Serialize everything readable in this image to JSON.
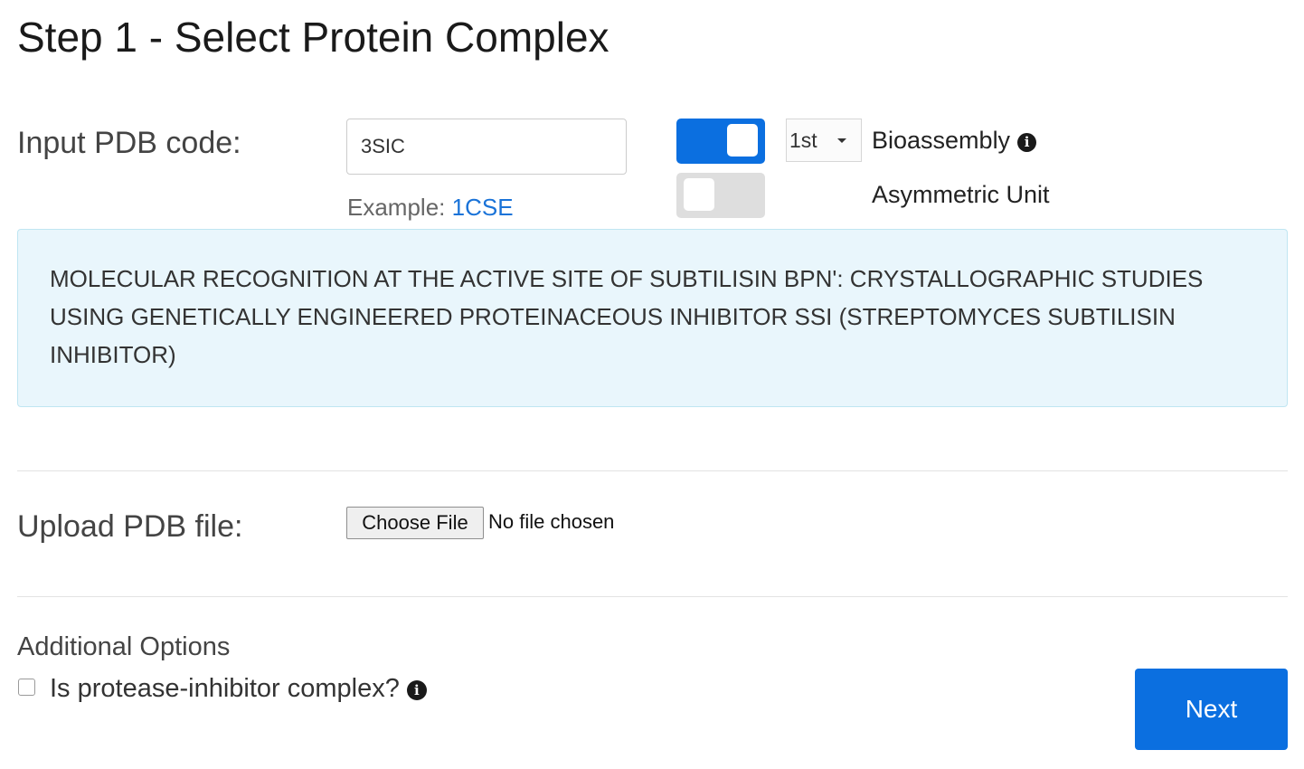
{
  "title": "Step 1 - Select Protein Complex",
  "pdb_code": {
    "label": "Input PDB code:",
    "value": "3SIC",
    "example_prefix": "Example:",
    "example_link": "1CSE"
  },
  "assembly": {
    "bioassembly_toggle_on": true,
    "asymmetric_toggle_on": false,
    "bioassembly_select_value": "1st",
    "bioassembly_label": "Bioassembly",
    "asymmetric_label": "Asymmetric Unit",
    "info_glyph": "i"
  },
  "description": "MOLECULAR RECOGNITION AT THE ACTIVE SITE OF SUBTILISIN BPN': CRYSTALLOGRAPHIC STUDIES USING GENETICALLY ENGINEERED PROTEINACEOUS INHIBITOR SSI (STREPTOMYCES SUBTILISIN INHIBITOR)",
  "upload": {
    "label": "Upload PDB file:",
    "button_label": "Choose File",
    "status": "No file chosen"
  },
  "options": {
    "heading": "Additional Options",
    "protease_checkbox_label": "Is protease-inhibitor complex?",
    "protease_checked": false
  },
  "next_button": "Next",
  "colors": {
    "accent": "#0b6fe0",
    "link": "#1a73d8",
    "info_bg": "#e9f6fc"
  },
  "icons": {
    "info": "info-circle-icon",
    "caret": "caret-down-icon"
  }
}
